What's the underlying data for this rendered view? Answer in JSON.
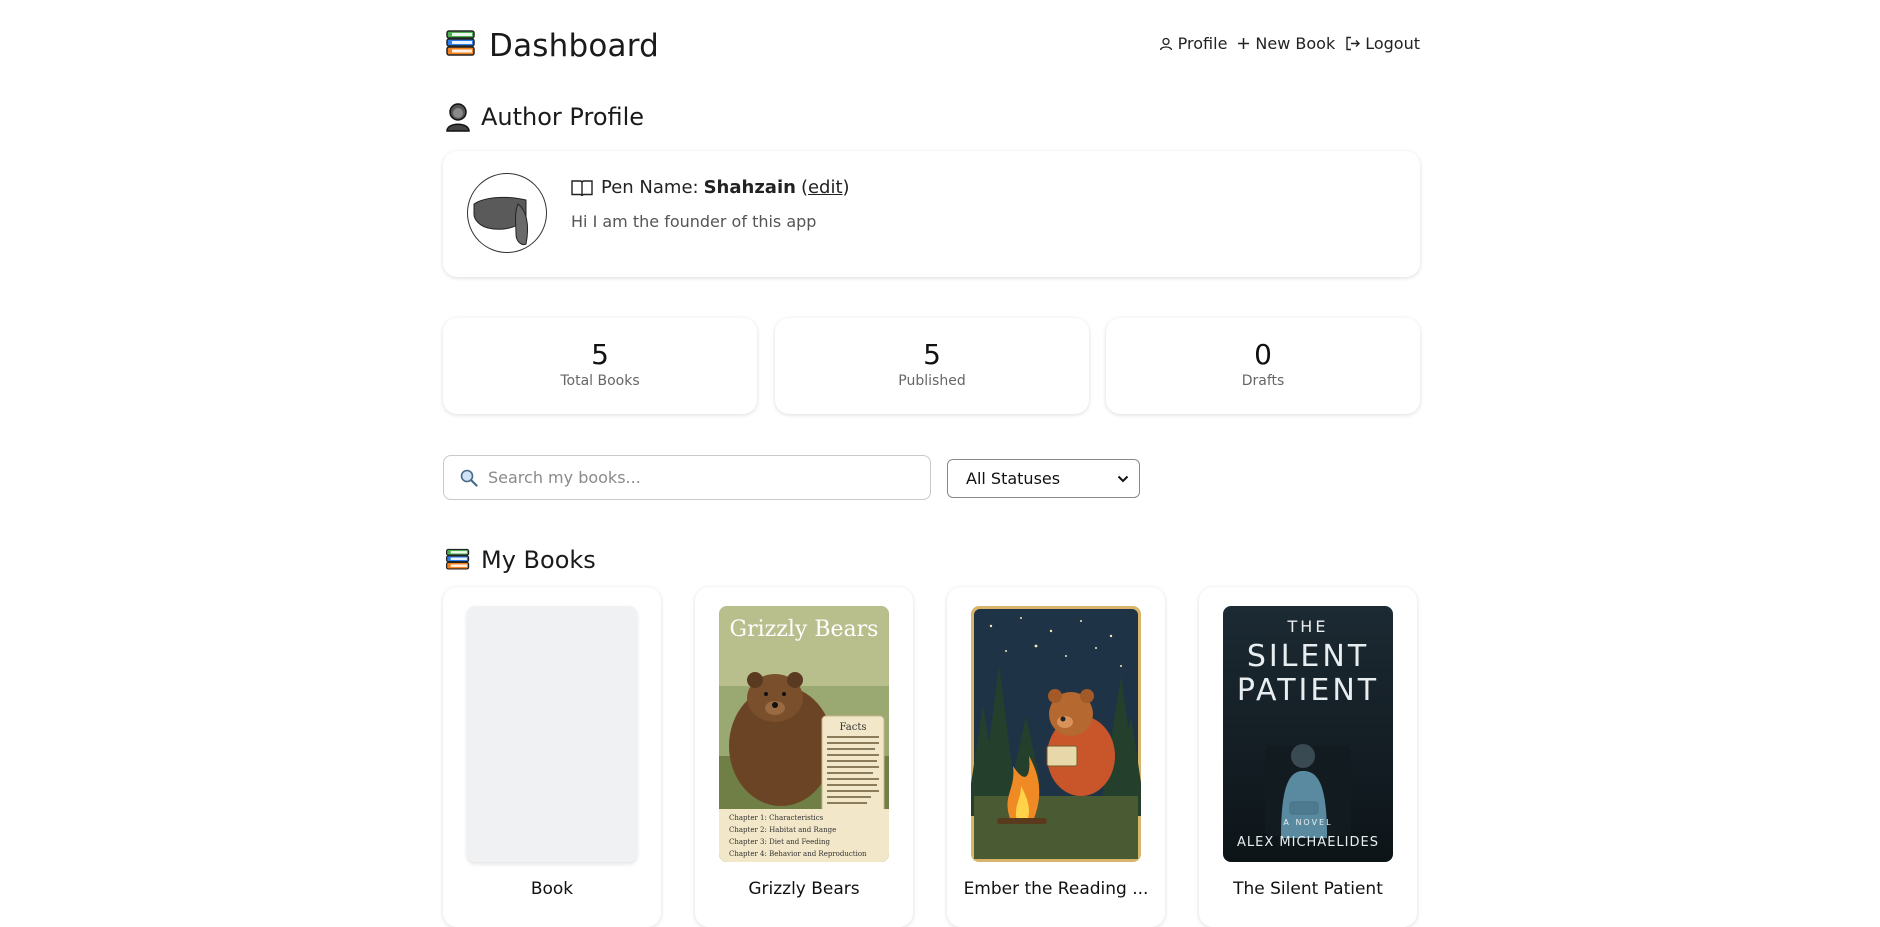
{
  "header": {
    "title": "Dashboard",
    "nav": {
      "profile": "Profile",
      "new_book": "New Book",
      "logout": "Logout"
    }
  },
  "profile_section": {
    "heading": "Author Profile",
    "pen_name_label": "Pen Name:",
    "pen_name": "Shahzain",
    "edit_label": "edit",
    "bio": "Hi I am the founder of this app"
  },
  "stats": [
    {
      "value": "5",
      "label": "Total Books"
    },
    {
      "value": "5",
      "label": "Published"
    },
    {
      "value": "0",
      "label": "Drafts"
    }
  ],
  "search": {
    "placeholder": "Search my books..."
  },
  "status_filter": {
    "selected": "All Statuses"
  },
  "books_section": {
    "heading": "My Books",
    "books": [
      {
        "title": "Book",
        "cover": "blank"
      },
      {
        "title": "Grizzly Bears",
        "cover": "grizzly-bears-cover",
        "cover_text": {
          "title": "Grizzly Bears",
          "facts_heading": "Facts",
          "chapters": [
            "Chapter 1: Characteristics",
            "Chapter 2: Habitat and Range",
            "Chapter 3: Diet and Feeding",
            "Chapter 4: Behavior and Reproduction"
          ]
        }
      },
      {
        "title": "Ember the Reading ...",
        "cover": "campfire-bear-cover"
      },
      {
        "title": "The Silent Patient",
        "cover": "silent-patient-cover",
        "cover_text": {
          "line1": "THE",
          "line2": "SILENT",
          "line3": "PATIENT",
          "tag": "A NOVEL",
          "author": "ALEX MICHAELIDES"
        }
      }
    ]
  },
  "colors": {
    "accent": "#1a1a1a",
    "card_shadow": "#d9d9d9",
    "placeholder": "#f0f1f3"
  }
}
